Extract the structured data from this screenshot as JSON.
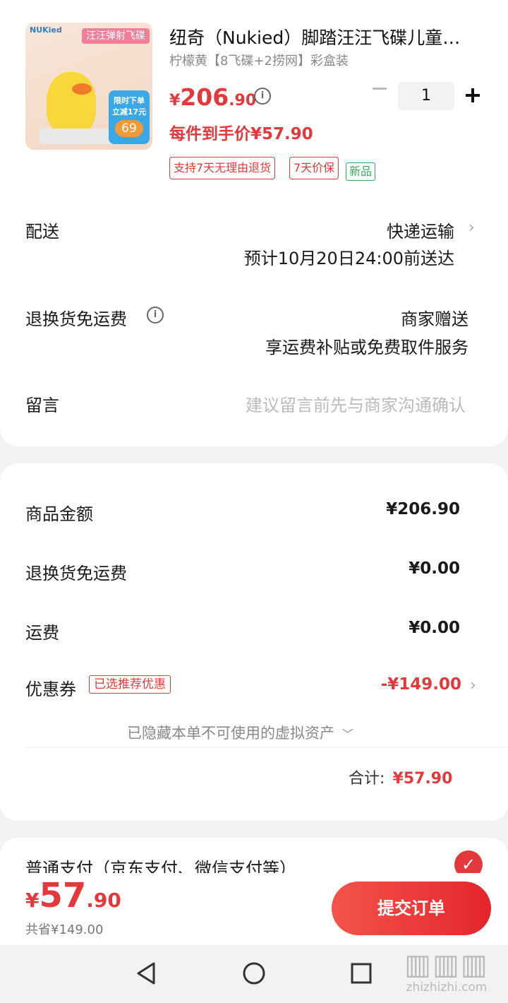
{
  "product": {
    "title": "纽奇（Nukied）脚踏汪汪飞碟儿童…",
    "spec": "柠檬黄【8飞碟+2捞网】彩盒装",
    "price_symbol": "¥",
    "price_int": "206",
    "price_dec": ".90",
    "unit_price": "每件到手价¥57.90",
    "quantity": "1",
    "tags": [
      "支持7天无理由退货",
      "7天价保"
    ],
    "new_tag": "新品",
    "image_brand": "NUKied",
    "image_banner": "汪汪弹射飞碟",
    "image_badge_line1": "限时下单",
    "image_badge_line2": "立减17元",
    "image_price": "69"
  },
  "delivery": {
    "label": "配送",
    "method": "快递运输",
    "eta": "预计10月20日24:00前送达"
  },
  "return_shipping": {
    "label": "退换货免运费",
    "value": "商家赠送",
    "desc": "享运费补贴或免费取件服务"
  },
  "message": {
    "label": "留言",
    "placeholder": "建议留言前先与商家沟通确认"
  },
  "summary": {
    "goods_label": "商品金额",
    "goods_value": "¥206.90",
    "return_label": "退换货免运费",
    "return_value": "¥0.00",
    "freight_label": "运费",
    "freight_value": "¥0.00",
    "coupon_label": "优惠券",
    "coupon_tag": "已选推荐优惠",
    "coupon_value": "-¥149.00",
    "hidden_assets": "已隐藏本单不可使用的虚拟资产",
    "total_label": "合计:",
    "total_value": "¥57.90"
  },
  "payment": {
    "label": "普通支付（京东支付、微信支付等）"
  },
  "bottom": {
    "price_symbol": "¥",
    "price_int": "57",
    "price_dec": ".90",
    "saved": "共省¥149.00",
    "submit": "提交订单"
  },
  "watermark": "zhizhizhi.com",
  "colors": {
    "accent": "#e4393c",
    "green": "#2dae5d",
    "background": "#f2f2f2"
  }
}
